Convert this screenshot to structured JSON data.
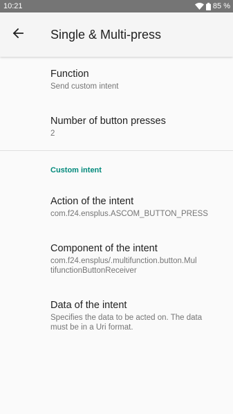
{
  "status_bar": {
    "time": "10:21",
    "battery": "85 %",
    "icons": [
      "wifi-icon",
      "battery-icon"
    ]
  },
  "app_bar": {
    "back_icon": "arrow-left-icon",
    "title": "Single & Multi-press"
  },
  "preferences": {
    "function": {
      "title": "Function",
      "summary": "Send custom intent"
    },
    "presses": {
      "title": "Number of button presses",
      "summary": "2"
    },
    "category": "Custom intent",
    "action": {
      "title": "Action of the intent",
      "summary": "com.f24.ensplus.ASCOM_BUTTON_PRESS"
    },
    "component": {
      "title": "Component of the intent",
      "summary_line1": "com.f24.ensplus/.multifunction.button.Mul",
      "summary_line2": "tifunctionButtonReceiver"
    },
    "data": {
      "title": "Data of the intent",
      "summary_line1": "Specifies the data to be acted on. The data",
      "summary_line2": "must be in a Uri format."
    }
  },
  "colors": {
    "status_bar": "#757575",
    "app_bar": "#f5f5f5",
    "accent": "#00897b",
    "background": "#fafafa"
  }
}
